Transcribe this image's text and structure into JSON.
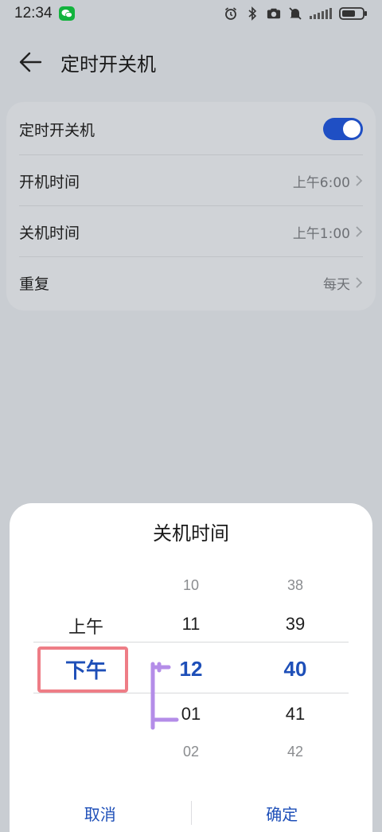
{
  "status_bar": {
    "time": "12:34",
    "icons": [
      "wechat-icon",
      "alarm-icon",
      "bluetooth-icon",
      "camera-icon",
      "mute-icon",
      "signal-icon",
      "battery-icon"
    ]
  },
  "header": {
    "title": "定时开关机",
    "back_icon": "arrow-left-icon"
  },
  "settings": {
    "toggle_label": "定时开关机",
    "toggle_on": true,
    "rows": [
      {
        "label": "开机时间",
        "value": "上午6:00"
      },
      {
        "label": "关机时间",
        "value": "上午1:00"
      },
      {
        "label": "重复",
        "value": "每天"
      }
    ]
  },
  "picker": {
    "title": "关机时间",
    "ampm": {
      "above": "上午",
      "selected": "下午"
    },
    "hours": {
      "far_above": "10",
      "above": "11",
      "selected": "12",
      "below": "01",
      "far_below": "02"
    },
    "minutes": {
      "far_above": "38",
      "above": "39",
      "selected": "40",
      "below": "41",
      "far_below": "42"
    },
    "cancel": "取消",
    "confirm": "确定"
  },
  "colors": {
    "accent": "#1e4fb8",
    "toggle": "#1f4fc4",
    "annotation_red": "#ee7d86",
    "annotation_purple": "#b48de8"
  }
}
